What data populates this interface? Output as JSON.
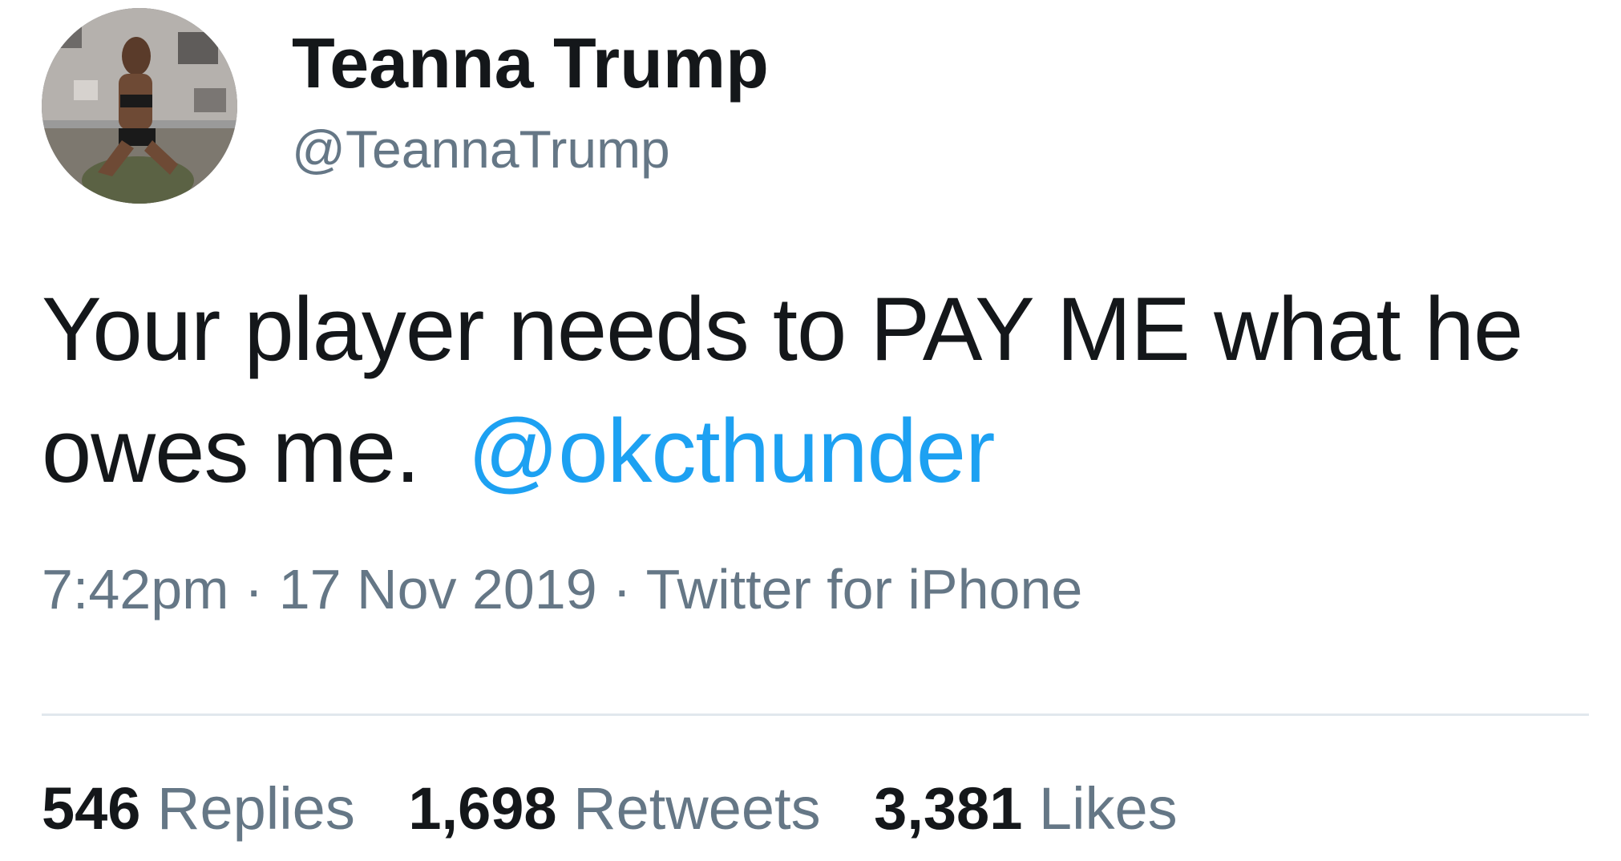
{
  "user": {
    "display_name": "Teanna Trump",
    "handle": "@TeannaTrump"
  },
  "tweet": {
    "text": "Your player needs to PAY ME what he owes me.",
    "mention": "@okcthunder",
    "time": "7:42pm",
    "date": "17 Nov 2019",
    "source": "Twitter for iPhone",
    "separator": "·"
  },
  "stats": {
    "replies_count": "546",
    "replies_label": "Replies",
    "retweets_count": "1,698",
    "retweets_label": "Retweets",
    "likes_count": "3,381",
    "likes_label": "Likes"
  },
  "colors": {
    "text": "#14171a",
    "secondary": "#657786",
    "link": "#1da1f2",
    "divider": "#e1e8ed"
  }
}
